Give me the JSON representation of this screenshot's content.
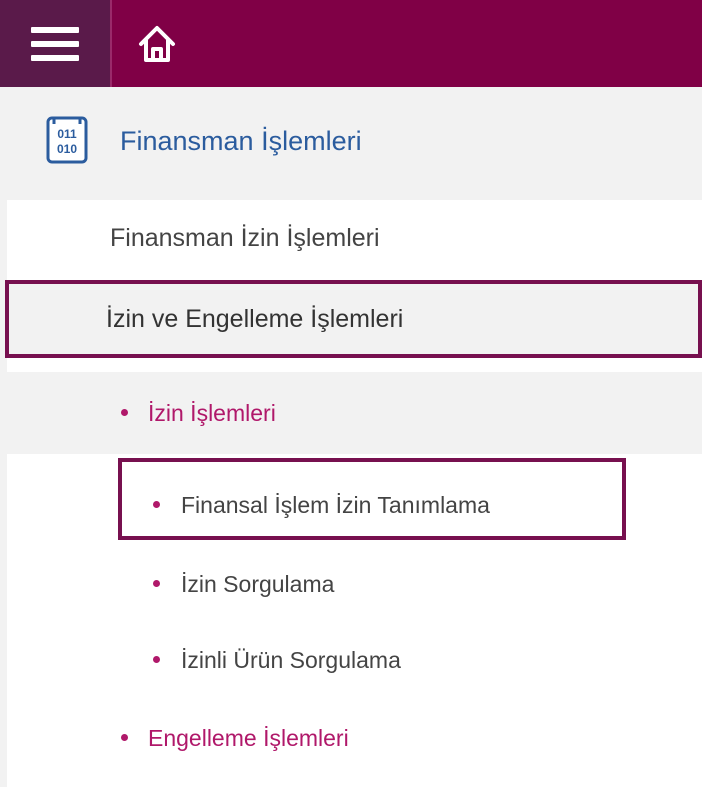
{
  "header": {
    "menu_icon": "hamburger-menu-icon",
    "home_icon": "home-icon",
    "bg_color": "#800046",
    "menu_bg_color": "#5a1a4a"
  },
  "section": {
    "icon": "binary-code-icon",
    "icon_text_top": "011",
    "icon_text_bottom": "010",
    "title": "Finansman İşlemleri",
    "title_color": "#2b5c9e"
  },
  "menu": {
    "items": [
      {
        "label": "Finansman İzin İşlemleri"
      },
      {
        "label": "İzin ve Engelleme İşlemleri",
        "highlighted": true
      }
    ],
    "submenu": {
      "groups": [
        {
          "label": "İzin İşlemleri",
          "color": "#b0186a",
          "children": [
            {
              "label": "Finansal İşlem İzin Tanımlama",
              "highlighted": true
            },
            {
              "label": "İzin Sorgulama"
            },
            {
              "label": "İzinli Ürün Sorgulama"
            }
          ]
        },
        {
          "label": "Engelleme İşlemleri",
          "color": "#b0186a"
        }
      ]
    }
  },
  "highlight_color": "#77104f"
}
